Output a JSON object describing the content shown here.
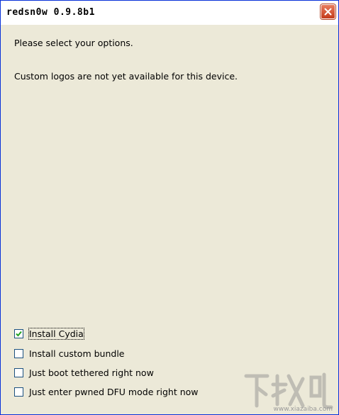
{
  "window": {
    "title": "redsn0w 0.9.8b1",
    "close_icon": "close-icon"
  },
  "main": {
    "prompt": "Please select your options.",
    "notice": "Custom logos are not yet available for this device."
  },
  "options": [
    {
      "label": "Install Cydia",
      "checked": true
    },
    {
      "label": "Install custom bundle",
      "checked": false
    },
    {
      "label": "Just boot tethered right now",
      "checked": false
    },
    {
      "label": "Just enter pwned DFU mode right now",
      "checked": false
    }
  ],
  "watermark": {
    "text": "下载吧",
    "url": "www.xiazaiba.com"
  },
  "colors": {
    "window_bg": "#ECE9D8",
    "close_button": "#C94A2A",
    "checkbox_border": "#1C5180"
  }
}
